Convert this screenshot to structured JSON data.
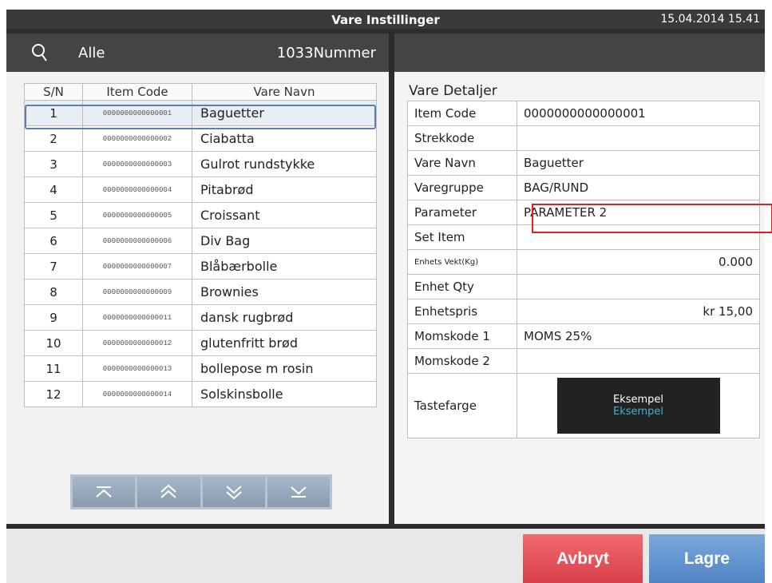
{
  "window": {
    "title": "Vare Instillinger",
    "datetime": "15.04.2014 15.41"
  },
  "left_header": {
    "search_icon": "search-icon",
    "category": "Alle",
    "count": "1033Nummer"
  },
  "table": {
    "headers": [
      "S/N",
      "Item Code",
      "Vare Navn"
    ],
    "rows": [
      {
        "sn": "1",
        "code": "0000000000000001",
        "name": "Baguetter"
      },
      {
        "sn": "2",
        "code": "0000000000000002",
        "name": "Ciabatta"
      },
      {
        "sn": "3",
        "code": "0000000000000003",
        "name": "Gulrot rundstykke"
      },
      {
        "sn": "4",
        "code": "0000000000000004",
        "name": "Pitabrød"
      },
      {
        "sn": "5",
        "code": "0000000000000005",
        "name": "Croissant"
      },
      {
        "sn": "6",
        "code": "0000000000000006",
        "name": "Div Bag"
      },
      {
        "sn": "7",
        "code": "0000000000000007",
        "name": "Blåbærbolle"
      },
      {
        "sn": "8",
        "code": "0000000000000009",
        "name": "Brownies"
      },
      {
        "sn": "9",
        "code": "0000000000000011",
        "name": "dansk rugbrød"
      },
      {
        "sn": "10",
        "code": "0000000000000012",
        "name": "glutenfritt brød"
      },
      {
        "sn": "11",
        "code": "0000000000000013",
        "name": "bollepose m rosin"
      },
      {
        "sn": "12",
        "code": "0000000000000014",
        "name": "Solskinsbolle"
      }
    ]
  },
  "nav_icons": [
    "first-page-icon",
    "page-up-icon",
    "page-down-icon",
    "last-page-icon"
  ],
  "details": {
    "title": "Vare Detaljer",
    "item_code": {
      "label": "Item Code",
      "value": "0000000000000001"
    },
    "barcode": {
      "label": "Strekkode",
      "value": ""
    },
    "name": {
      "label": "Vare Navn",
      "value": "Baguetter"
    },
    "group": {
      "label": "Varegruppe",
      "value": "BAG/RUND"
    },
    "parameter": {
      "label": "Parameter",
      "value": "PARAMETER 2"
    },
    "set_item": {
      "label": "Set Item",
      "value": ""
    },
    "unit_weight": {
      "label": "Enhets Vekt(Kg)",
      "value": "0.000"
    },
    "unit_qty": {
      "label": "Enhet Qty",
      "value": ""
    },
    "unit_price": {
      "label": "Enhetspris",
      "value": "kr 15,00"
    },
    "vat1": {
      "label": "Momskode 1",
      "value": "MOMS 25%"
    },
    "vat2": {
      "label": "Momskode 2",
      "value": ""
    },
    "key_color": {
      "label": "Tastefarge",
      "sample1": "Eksempel",
      "sample2": "Eksempel"
    }
  },
  "buttons": {
    "cancel": "Avbryt",
    "save": "Lagre"
  },
  "colors": {
    "cancel": "#e0454e",
    "save": "#5c8fcc",
    "highlight": "#e02020",
    "sample_text_2": "#3fb2d4"
  }
}
